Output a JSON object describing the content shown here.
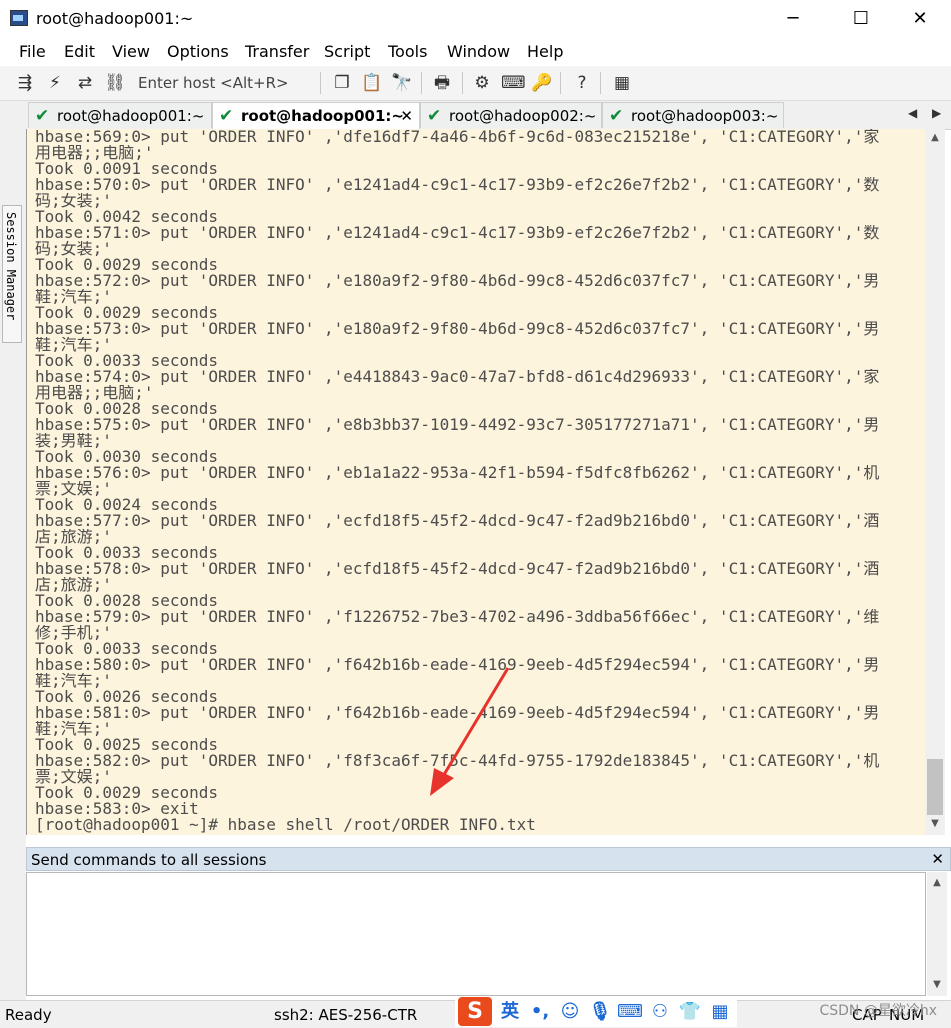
{
  "window": {
    "title": "root@hadoop001:~",
    "minimize": "─",
    "maximize": "☐",
    "close": "✕"
  },
  "menu": [
    "File",
    "Edit",
    "View",
    "Options",
    "Transfer",
    "Script",
    "Tools",
    "Window",
    "Help"
  ],
  "toolbar": {
    "host_placeholder": "Enter host <Alt+R>"
  },
  "tabs": [
    {
      "label": "root@hadoop001:~",
      "active": false
    },
    {
      "label": "root@hadoop001:~",
      "active": true,
      "close": "✕"
    },
    {
      "label": "root@hadoop002:~",
      "active": false
    },
    {
      "label": "root@hadoop003:~",
      "active": false
    }
  ],
  "session_manager": "Session Manager",
  "terminal": {
    "lines": [
      "hbase:569:0> put 'ORDER_INFO' ,'dfe16df7-4a46-4b6f-9c6d-083ec215218e', 'C1:CATEGORY','家",
      "用电器;;电脑;'",
      "Took 0.0091 seconds",
      "hbase:570:0> put 'ORDER_INFO' ,'e1241ad4-c9c1-4c17-93b9-ef2c26e7f2b2', 'C1:CATEGORY','数",
      "码;女装;'",
      "Took 0.0042 seconds",
      "hbase:571:0> put 'ORDER_INFO' ,'e1241ad4-c9c1-4c17-93b9-ef2c26e7f2b2', 'C1:CATEGORY','数",
      "码;女装;'",
      "Took 0.0029 seconds",
      "hbase:572:0> put 'ORDER_INFO' ,'e180a9f2-9f80-4b6d-99c8-452d6c037fc7', 'C1:CATEGORY','男",
      "鞋;汽车;'",
      "Took 0.0029 seconds",
      "hbase:573:0> put 'ORDER_INFO' ,'e180a9f2-9f80-4b6d-99c8-452d6c037fc7', 'C1:CATEGORY','男",
      "鞋;汽车;'",
      "Took 0.0033 seconds",
      "hbase:574:0> put 'ORDER_INFO' ,'e4418843-9ac0-47a7-bfd8-d61c4d296933', 'C1:CATEGORY','家",
      "用电器;;电脑;'",
      "Took 0.0028 seconds",
      "hbase:575:0> put 'ORDER_INFO' ,'e8b3bb37-1019-4492-93c7-305177271a71', 'C1:CATEGORY','男",
      "装;男鞋;'",
      "Took 0.0030 seconds",
      "hbase:576:0> put 'ORDER_INFO' ,'eb1a1a22-953a-42f1-b594-f5dfc8fb6262', 'C1:CATEGORY','机",
      "票;文娱;'",
      "Took 0.0024 seconds",
      "hbase:577:0> put 'ORDER_INFO' ,'ecfd18f5-45f2-4dcd-9c47-f2ad9b216bd0', 'C1:CATEGORY','酒",
      "店;旅游;'",
      "Took 0.0033 seconds",
      "hbase:578:0> put 'ORDER_INFO' ,'ecfd18f5-45f2-4dcd-9c47-f2ad9b216bd0', 'C1:CATEGORY','酒",
      "店;旅游;'",
      "Took 0.0028 seconds",
      "hbase:579:0> put 'ORDER_INFO' ,'f1226752-7be3-4702-a496-3ddba56f66ec', 'C1:CATEGORY','维",
      "修;手机;'",
      "Took 0.0033 seconds",
      "hbase:580:0> put 'ORDER_INFO' ,'f642b16b-eade-4169-9eeb-4d5f294ec594', 'C1:CATEGORY','男",
      "鞋;汽车;'",
      "Took 0.0026 seconds",
      "hbase:581:0> put 'ORDER_INFO' ,'f642b16b-eade-4169-9eeb-4d5f294ec594', 'C1:CATEGORY','男",
      "鞋;汽车;'",
      "Took 0.0025 seconds",
      "hbase:582:0> put 'ORDER_INFO' ,'f8f3ca6f-7f5c-44fd-9755-1792de183845', 'C1:CATEGORY','机",
      "票;文娱;'",
      "Took 0.0029 seconds",
      "hbase:583:0> exit",
      "[root@hadoop001 ~]# hbase shell /root/ORDER_INFO.txt"
    ]
  },
  "send_commands": {
    "label": "Send commands to all sessions",
    "close": "✕"
  },
  "status": {
    "ready": "Ready",
    "cipher": "ssh2: AES-256-CTR",
    "caps": "CAP",
    "num": "NUM"
  },
  "ime": {
    "logo": "S",
    "lang": "英"
  },
  "watermark": "CSDN @星欲冷hx"
}
